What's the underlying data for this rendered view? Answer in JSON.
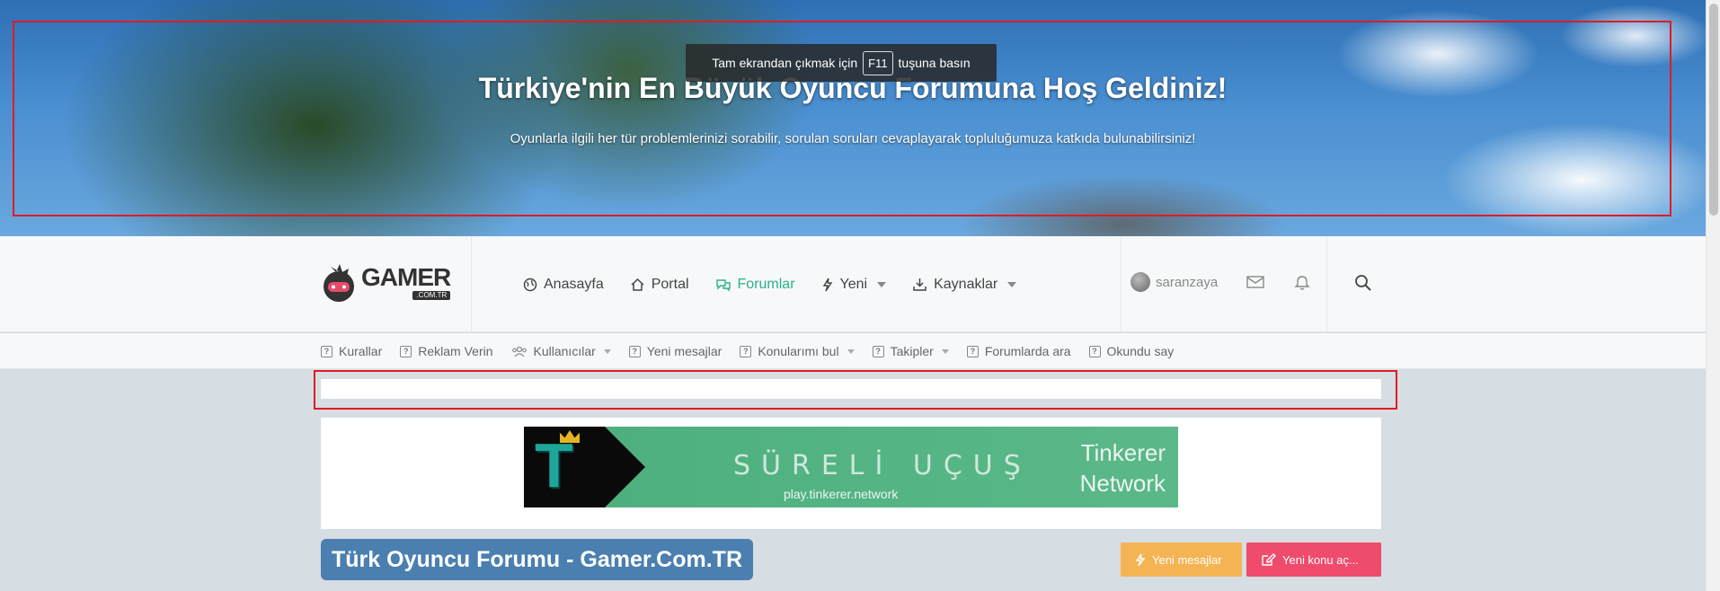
{
  "hero": {
    "fullscreen_prefix": "Tam ekrandan çıkmak için",
    "fullscreen_key": "F11",
    "fullscreen_suffix": "tuşuna basın",
    "title": "Türkiye'nin En Büyük Oyuncu Forumuna Hoş Geldiniz!",
    "subtitle": "Oyunlarla ilgili her tür problemlerinizi sorabilir, sorulan soruları cevaplayarak topluluğumuza katkıda bulunabilirsiniz!"
  },
  "logo": {
    "word": "GAMER",
    "badge": ".COM.TR"
  },
  "nav": {
    "items": [
      {
        "label": "Anasayfa",
        "icon": "globe-icon"
      },
      {
        "label": "Portal",
        "icon": "home-icon"
      },
      {
        "label": "Forumlar",
        "icon": "comments-icon",
        "active": true
      },
      {
        "label": "Yeni",
        "icon": "bolt-icon",
        "dropdown": true
      },
      {
        "label": "Kaynaklar",
        "icon": "download-icon",
        "dropdown": true
      }
    ]
  },
  "user": {
    "name": "saranzaya"
  },
  "subnav": {
    "items": [
      {
        "label": "Kurallar"
      },
      {
        "label": "Reklam Verin"
      },
      {
        "label": "Kullanıcılar",
        "dropdown": true
      },
      {
        "label": "Yeni mesajlar"
      },
      {
        "label": "Konularımı bul",
        "dropdown": true
      },
      {
        "label": "Takipler",
        "dropdown": true
      },
      {
        "label": "Forumlarda ara"
      },
      {
        "label": "Okundu say"
      }
    ]
  },
  "banner": {
    "letter": "T",
    "title": "SÜRELİ UÇUŞ",
    "url": "play.tinkerer.network",
    "brand_line1": "Tinkerer",
    "brand_line2": "Network"
  },
  "page": {
    "title": "Türk Oyuncu Forumu - Gamer.Com.TR"
  },
  "buttons": {
    "new_messages": "Yeni mesajlar",
    "new_thread": "Yeni konu aç..."
  },
  "colors": {
    "accent": "#2bb08d",
    "title_bg": "#4a7fb0",
    "btn_yellow": "#f5b453",
    "btn_red": "#ef4b6c",
    "annotation": "#e01b24"
  }
}
